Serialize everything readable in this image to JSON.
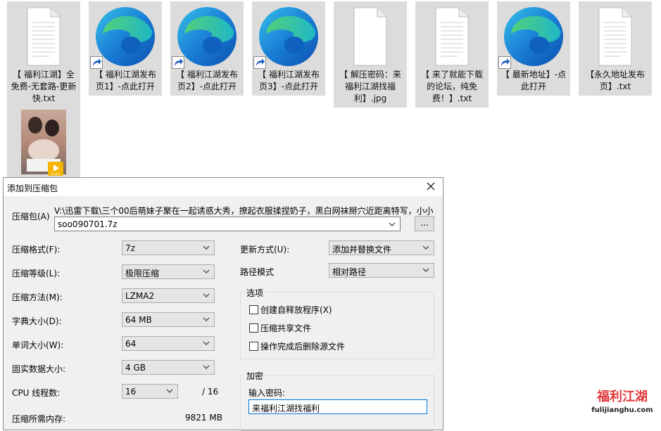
{
  "desktop": {
    "files": [
      {
        "label": "【 福利江湖】全免费-无套路-更新快.txt",
        "kind": "txt"
      },
      {
        "label": "【 福利江湖发布页1】-点此打开",
        "kind": "edge"
      },
      {
        "label": "【 福利江湖发布页2】-点此打开",
        "kind": "edge"
      },
      {
        "label": "【 福利江湖发布页3】-点此打开",
        "kind": "edge"
      },
      {
        "label": "【 解压密码：来福利江湖找福利】.jpg",
        "kind": "txt"
      },
      {
        "label": "【 来了就能下载的论坛，纯免费！】.txt",
        "kind": "txt"
      },
      {
        "label": "【 最新地址】-点此打开",
        "kind": "edge"
      },
      {
        "label": "【永久地址发布页】.txt",
        "kind": "txt"
      },
      {
        "label": "",
        "kind": "video",
        "badge": "Player"
      }
    ]
  },
  "dialog": {
    "title": "添加到压缩包",
    "archive_label": "压缩包(A)",
    "archive_path": "V:\\迅雷下载\\三个00后萌妹子聚在一起诱惑大秀，撩起衣服揉捏奶子，黑白网袜掰穴近距离特写，小小",
    "archive_name": "soo090701.7z",
    "browse_label": "...",
    "format_label": "压缩格式(F):",
    "format_value": "7z",
    "level_label": "压缩等级(L):",
    "level_value": "极限压缩",
    "method_label": "压缩方法(M):",
    "method_value": "LZMA2",
    "dict_label": "字典大小(D):",
    "dict_value": "64 MB",
    "word_label": "单词大小(W):",
    "word_value": "64",
    "solid_label": "固实数据大小:",
    "solid_value": "4 GB",
    "threads_label": "CPU 线程数:",
    "threads_value": "16",
    "threads_total": "/ 16",
    "memory_label": "压缩所需内存:",
    "memory_value": "9821 MB",
    "update_label": "更新方式(U):",
    "update_value": "添加并替换文件",
    "pathmode_label": "路径模式",
    "pathmode_value": "相对路径",
    "options_title": "选项",
    "opt_sfx": "创建自释放程序(X)",
    "opt_shared": "压缩共享文件",
    "opt_delete": "操作完成后删除源文件",
    "encrypt_title": "加密",
    "password_label": "输入密码:",
    "password_value": "来福利江湖找福利"
  },
  "watermark": {
    "text_cn": "福利江湖",
    "text_url": "fulijianghu.com"
  },
  "colors": {
    "accent": "#0078d7",
    "file_bg": "#dcdcdc",
    "dialog_bg": "#f0f0f0",
    "watermark": "#e03a3a"
  }
}
